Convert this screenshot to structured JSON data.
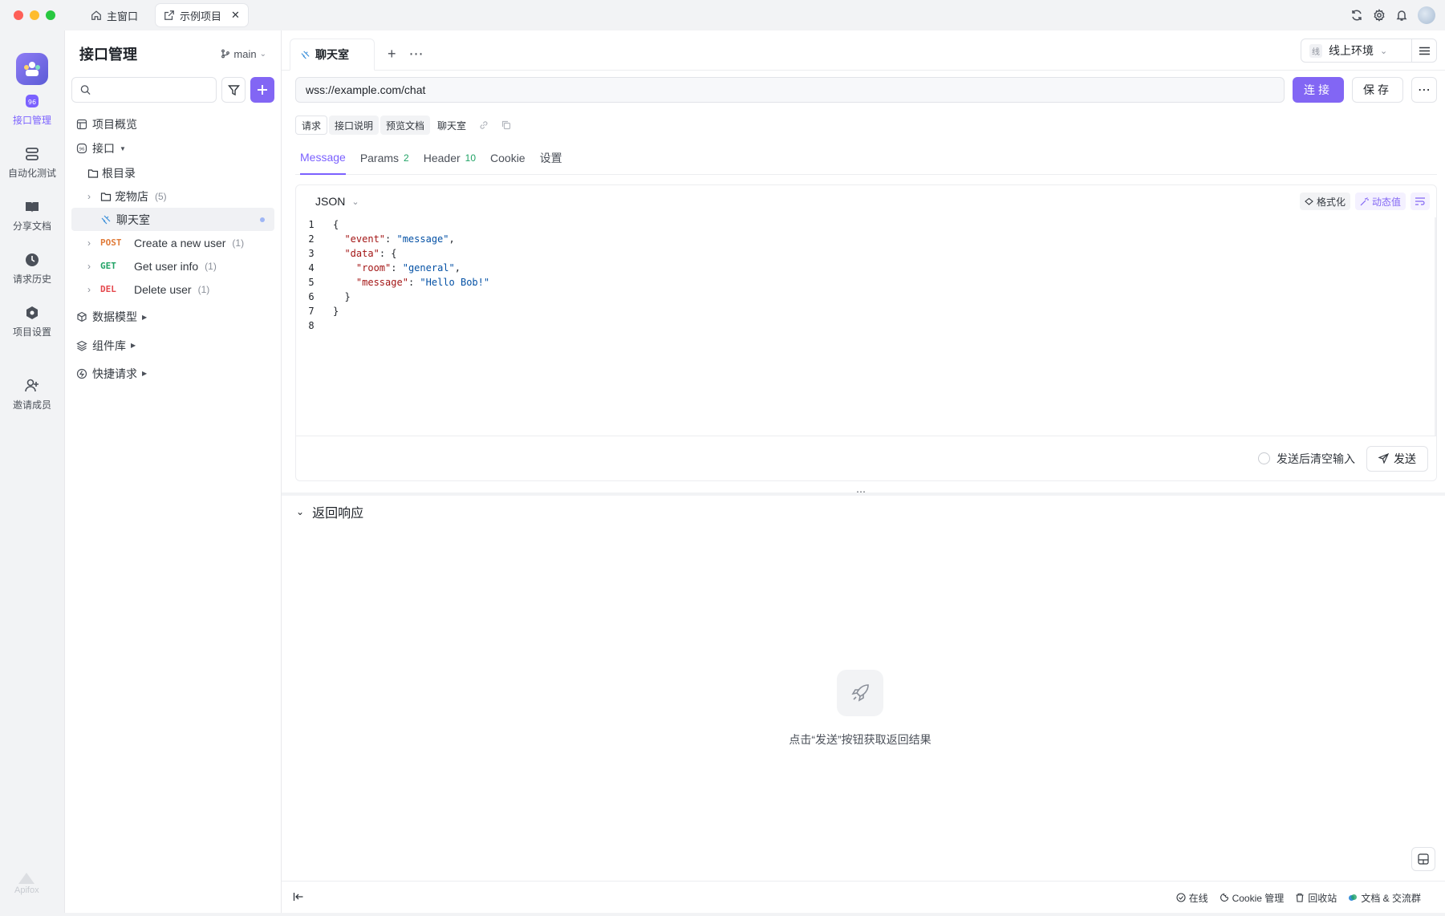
{
  "titlebar": {
    "home_tab": "主窗口",
    "project_tab": "示例项目"
  },
  "rail": {
    "items": [
      {
        "label": "接口管理"
      },
      {
        "label": "自动化测试"
      },
      {
        "label": "分享文档"
      },
      {
        "label": "请求历史"
      },
      {
        "label": "项目设置"
      },
      {
        "label": "邀请成员"
      }
    ],
    "brand": "Apifox"
  },
  "sidebar": {
    "title": "接口管理",
    "branch": "main",
    "search_placeholder": "",
    "overview": "项目概览",
    "api_root": "接口",
    "root_dir": "根目录",
    "folder": {
      "name": "宠物店",
      "count": "(5)"
    },
    "selected": "聊天室",
    "endpoints": [
      {
        "method": "POST",
        "name": "Create a new user",
        "count": "(1)"
      },
      {
        "method": "GET",
        "name": "Get user info",
        "count": "(1)"
      },
      {
        "method": "DEL",
        "name": "Delete user",
        "count": "(1)"
      }
    ],
    "sections": [
      "数据模型",
      "组件库",
      "快捷请求"
    ]
  },
  "main": {
    "tab": "聊天室",
    "env": {
      "badge": "线",
      "name": "线上环境"
    },
    "url": "wss://example.com/chat",
    "connect": "连接",
    "save": "保存",
    "subtabs": [
      "请求",
      "接口说明",
      "预览文档",
      "聊天室"
    ],
    "req_tabs": [
      {
        "label": "Message",
        "n": ""
      },
      {
        "label": "Params",
        "n": "2"
      },
      {
        "label": "Header",
        "n": "10"
      },
      {
        "label": "Cookie",
        "n": ""
      },
      {
        "label": "设置",
        "n": ""
      }
    ],
    "editor": {
      "lang": "JSON",
      "format": "格式化",
      "dynamic": "动态值"
    },
    "clear_after_send": "发送后清空输入",
    "send": "发送",
    "response_title": "返回响应",
    "empty_hint": "点击“发送”按钮获取返回结果"
  },
  "code_lines": [
    {
      "n": "1",
      "parts": [
        [
          "p",
          "{"
        ]
      ]
    },
    {
      "n": "2",
      "parts": [
        [
          "p",
          "  "
        ],
        [
          "k",
          "\"event\""
        ],
        [
          "p",
          ": "
        ],
        [
          "v",
          "\"message\""
        ],
        [
          "p",
          ","
        ]
      ]
    },
    {
      "n": "3",
      "parts": [
        [
          "p",
          "  "
        ],
        [
          "k",
          "\"data\""
        ],
        [
          "p",
          ": {"
        ]
      ]
    },
    {
      "n": "4",
      "parts": [
        [
          "p",
          "    "
        ],
        [
          "k",
          "\"room\""
        ],
        [
          "p",
          ": "
        ],
        [
          "v",
          "\"general\""
        ],
        [
          "p",
          ","
        ]
      ]
    },
    {
      "n": "5",
      "parts": [
        [
          "p",
          "    "
        ],
        [
          "k",
          "\"message\""
        ],
        [
          "p",
          ": "
        ],
        [
          "v",
          "\"Hello Bob!\""
        ]
      ]
    },
    {
      "n": "6",
      "parts": [
        [
          "p",
          "  }"
        ]
      ]
    },
    {
      "n": "7",
      "parts": [
        [
          "p",
          "}"
        ]
      ]
    },
    {
      "n": "8",
      "parts": [
        [
          "p",
          ""
        ]
      ]
    }
  ],
  "statusbar": {
    "online": "在线",
    "cookie": "Cookie 管理",
    "trash": "回收站",
    "docs": "文档 & 交流群"
  },
  "colors": {
    "accent": "#8266f4",
    "post": "#e07b39",
    "get": "#21a366",
    "del": "#e5484d"
  }
}
